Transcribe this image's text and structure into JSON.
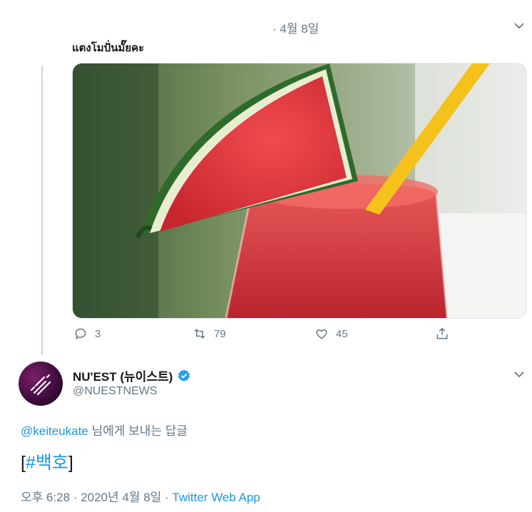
{
  "top_tweet": {
    "date": "· 4월 8일",
    "text": "แตงโมปั่นมั๊ยคะ",
    "image_alt": "watermelon smoothie",
    "actions": {
      "reply_count": "3",
      "retweet_count": "79",
      "like_count": "45"
    }
  },
  "reply_tweet": {
    "name": "NU'EST (뉴이스트)",
    "handle": "@NUESTNEWS",
    "replying_to_mention": "@keiteukate",
    "replying_to_suffix": " 님에게 보내는 답글",
    "body_open": "[",
    "hashtag": "#백호",
    "body_close": "]",
    "timestamp": "오후 6:28 · 2020년 4월 8일 · ",
    "source": "Twitter Web App"
  },
  "colors": {
    "accent": "#1b95e0",
    "secondary_text": "#657786",
    "verified": "#1da1f2"
  },
  "icons": [
    "chevron-down-icon",
    "reply-icon",
    "retweet-icon",
    "like-icon",
    "share-icon",
    "verified-icon"
  ]
}
